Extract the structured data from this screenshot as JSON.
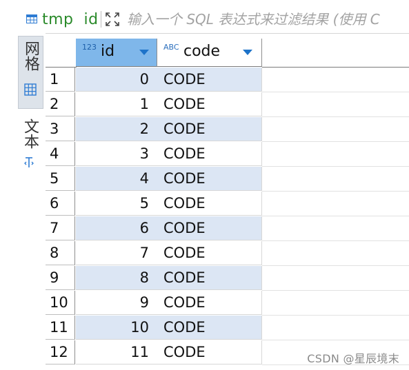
{
  "toolbar": {
    "table_name": "tmp  id",
    "filter_placeholder": "输入一个 SQL 表达式来过滤结果 (使用 C"
  },
  "side_tabs": {
    "grid_label": "网格",
    "text_label": "文本"
  },
  "columns": [
    {
      "type_badge": "123",
      "label": "id"
    },
    {
      "type_badge": "ABC",
      "label": "code"
    }
  ],
  "rows": [
    {
      "num": "1",
      "id": "0",
      "code": "CODE"
    },
    {
      "num": "2",
      "id": "1",
      "code": "CODE"
    },
    {
      "num": "3",
      "id": "2",
      "code": "CODE"
    },
    {
      "num": "4",
      "id": "3",
      "code": "CODE"
    },
    {
      "num": "5",
      "id": "4",
      "code": "CODE"
    },
    {
      "num": "6",
      "id": "5",
      "code": "CODE"
    },
    {
      "num": "7",
      "id": "6",
      "code": "CODE"
    },
    {
      "num": "8",
      "id": "7",
      "code": "CODE"
    },
    {
      "num": "9",
      "id": "8",
      "code": "CODE"
    },
    {
      "num": "10",
      "id": "9",
      "code": "CODE"
    },
    {
      "num": "11",
      "id": "10",
      "code": "CODE"
    },
    {
      "num": "12",
      "id": "11",
      "code": "CODE"
    }
  ],
  "watermark": "CSDN @星辰境末",
  "colors": {
    "selected_header": "#7fb7ea",
    "alt_row": "#dce6f4",
    "table_name": "#2a8a2a",
    "accent": "#1e73c9"
  },
  "icons": {
    "table": "table-icon",
    "expand": "expand-icon",
    "grid": "grid-icon",
    "text": "text-icon",
    "sort": "sort-arrow-icon"
  }
}
